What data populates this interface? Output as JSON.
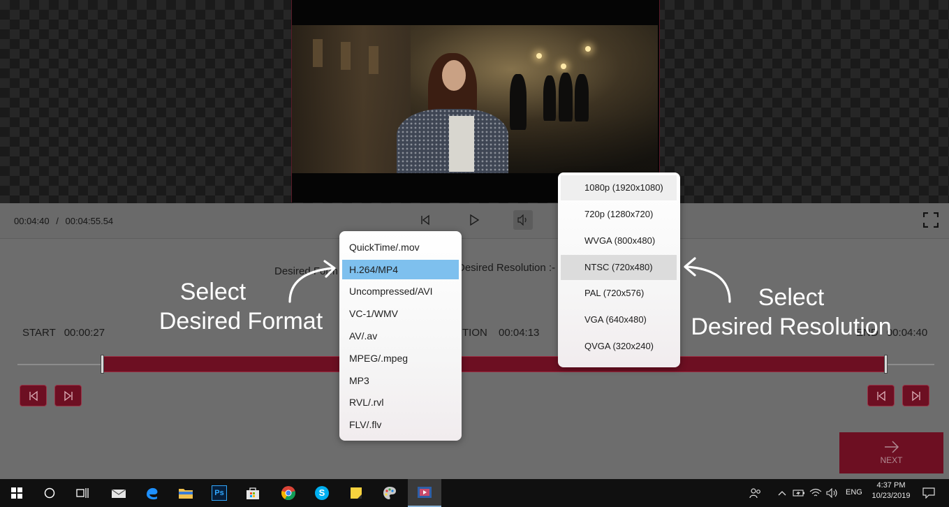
{
  "playback": {
    "current_time": "00:04:40",
    "separator": "/",
    "total_time": "00:04:55.54"
  },
  "labels": {
    "desired_format": "Desired Form",
    "desired_resolution": "Desired Resolution :-",
    "start": "START",
    "start_time": "00:00:27",
    "duration": "TION",
    "duration_time": "00:04:13",
    "end": "END",
    "end_time": "00:04:40"
  },
  "format_dropdown": {
    "selected": "H.264/MP4",
    "options": [
      "QuickTime/.mov",
      "H.264/MP4",
      "Uncompressed/AVI",
      "VC-1/WMV",
      "AV/.av",
      "MPEG/.mpeg",
      "MP3",
      "RVL/.rvl",
      "FLV/.flv"
    ]
  },
  "resolution_dropdown": {
    "selected": "NTSC (720x480)",
    "options": [
      "1080p (1920x1080)",
      "720p (1280x720)",
      "WVGA (800x480)",
      "NTSC (720x480)",
      "PAL (720x576)",
      "VGA (640x480)",
      "QVGA (320x240)"
    ]
  },
  "callouts": {
    "format_line1": "Select",
    "format_line2": "Desired Format",
    "resolution_line1": "Select",
    "resolution_line2": "Desired Resolution"
  },
  "next_button": {
    "label": "NEXT"
  },
  "taskbar": {
    "language": "ENG",
    "clock_time": "4:37 PM",
    "clock_date": "10/23/2019",
    "photoshop_label": "Ps",
    "skype_label": "S"
  },
  "colors": {
    "accent": "#6d0f22",
    "selection_blue": "#7ec0ee",
    "panel_gray": "#6d6d6d"
  }
}
